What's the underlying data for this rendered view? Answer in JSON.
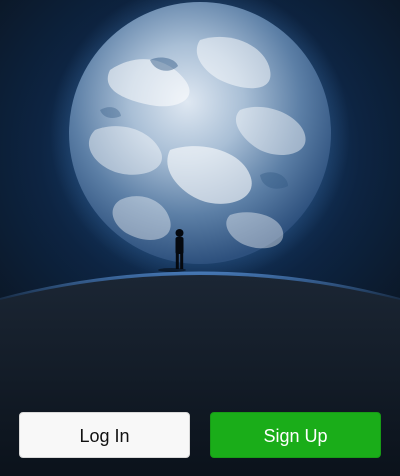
{
  "splash": {
    "background_color": "#0b1624",
    "earth_icon": "earth-globe-icon",
    "figure_icon": "standing-person-silhouette-icon"
  },
  "actions": {
    "login_label": "Log In",
    "signup_label": "Sign Up",
    "login_color": "#f8f8f8",
    "signup_color": "#1aad19"
  }
}
